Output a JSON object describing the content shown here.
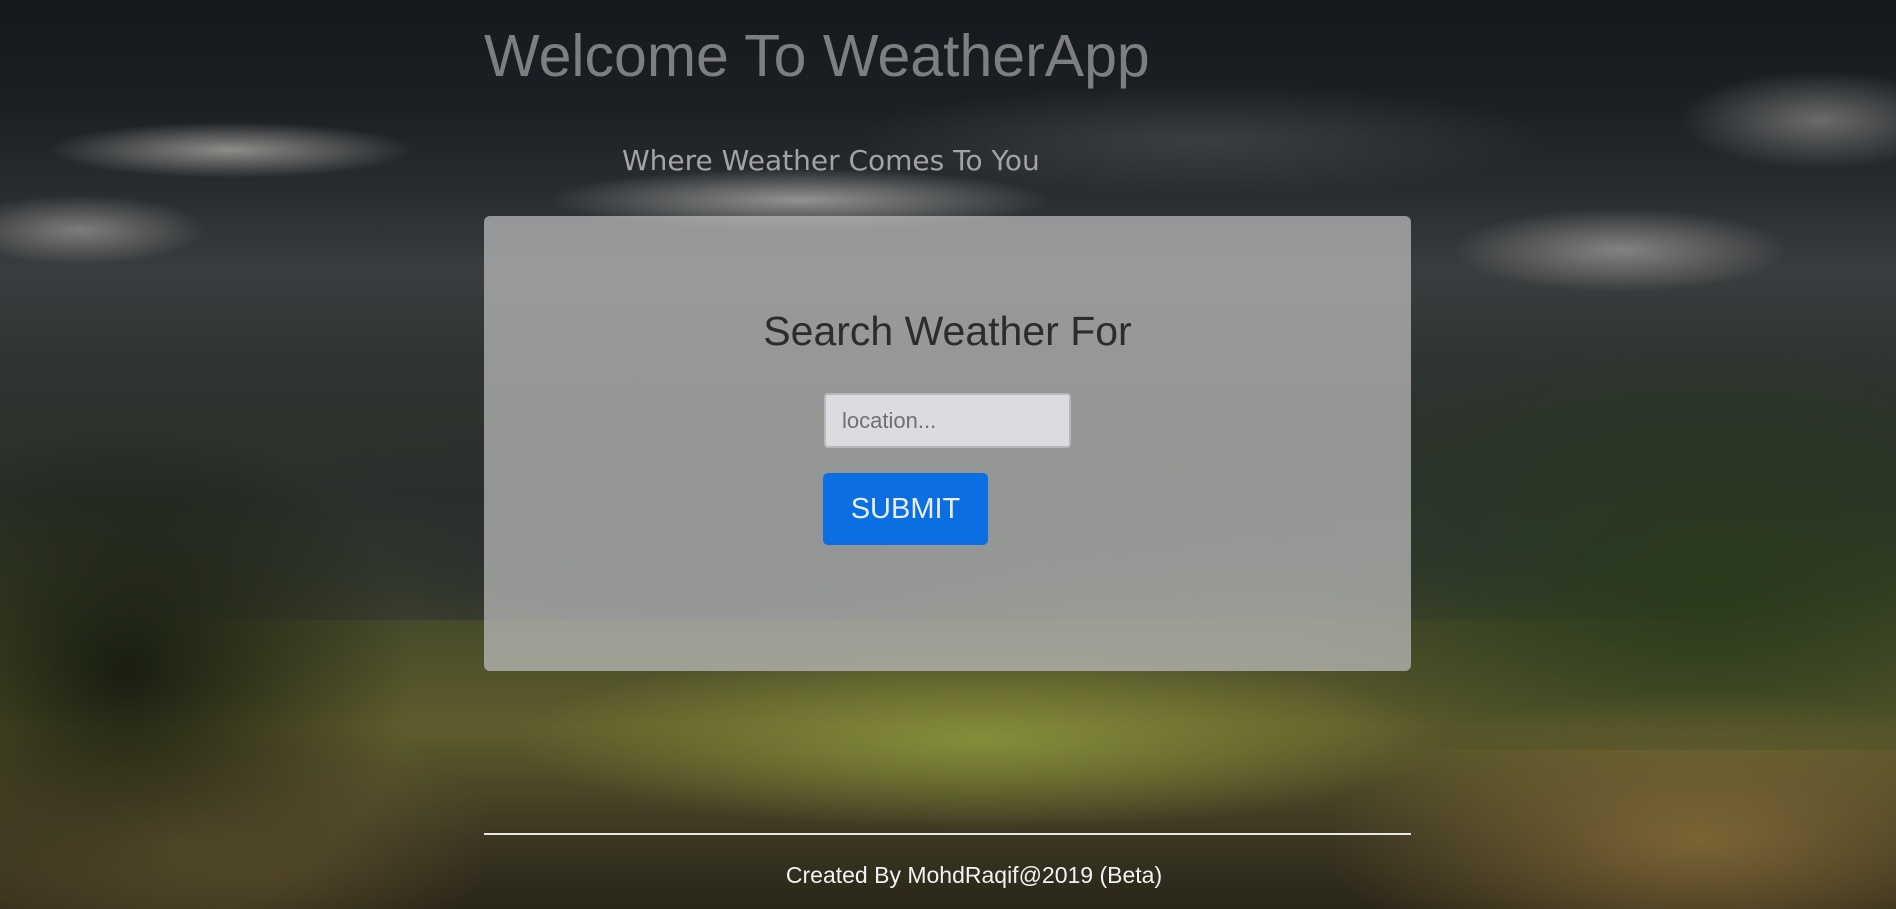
{
  "header": {
    "title": "Welcome To WeatherApp",
    "subtitle": "Where Weather Comes To You"
  },
  "search_card": {
    "heading": "Search Weather For",
    "location_placeholder": "location...",
    "location_value": "",
    "submit_label": "SUBMIT"
  },
  "footer": {
    "credit": "Created By MohdRaqif@2019 (Beta)"
  },
  "colors": {
    "submit_button": "#0b6ee2",
    "title_text": "#7d7e82",
    "card_background": "#bebebe"
  }
}
